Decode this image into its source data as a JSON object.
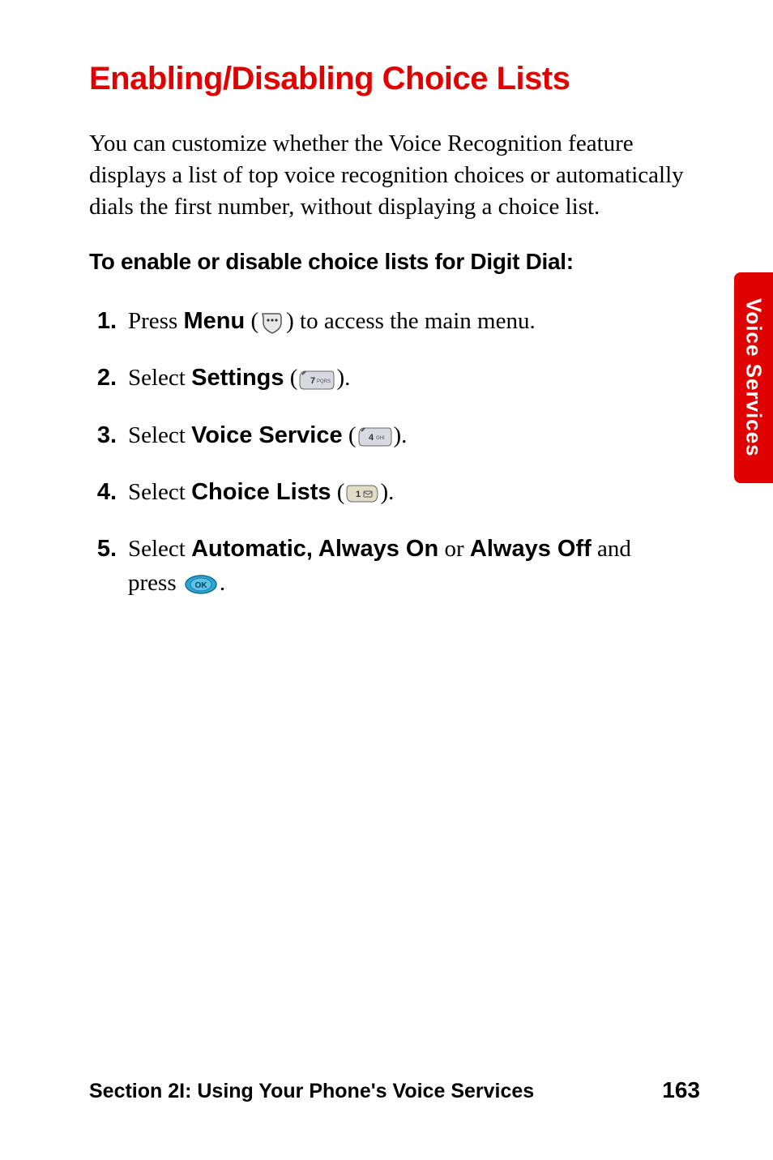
{
  "heading": "Enabling/Disabling Choice Lists",
  "intro": "You can customize whether the Voice Recognition feature displays a list of top voice recognition choices or automatically dials the first number, without displaying a choice list.",
  "subheading": "To enable or disable choice lists for Digit Dial:",
  "steps": [
    {
      "num": "1.",
      "pre": "Press ",
      "bold": "Menu",
      "post_open": " (",
      "icon": "menu-key-icon",
      "post_close": ") to access the main menu."
    },
    {
      "num": "2.",
      "pre": "Select ",
      "bold": "Settings",
      "post_open": " (",
      "icon": "key-7-pqrs-icon",
      "post_close": ")."
    },
    {
      "num": "3.",
      "pre": "Select ",
      "bold": "Voice Service",
      "post_open": " (",
      "icon": "key-4-ghi-icon",
      "post_close": ")."
    },
    {
      "num": "4.",
      "pre": "Select ",
      "bold": "Choice Lists",
      "post_open": " (",
      "icon": "key-1-icon",
      "post_close": ")."
    },
    {
      "num": "5.",
      "pre": "Select ",
      "bold": "Automatic, Always On",
      "mid": " or ",
      "bold2": "Always Off",
      "post": " and press ",
      "icon": "ok-key-icon",
      "post_close": "."
    }
  ],
  "tab_label": "Voice Services",
  "footer_left": "Section 2I: Using Your Phone's Voice Services",
  "footer_right": "163"
}
